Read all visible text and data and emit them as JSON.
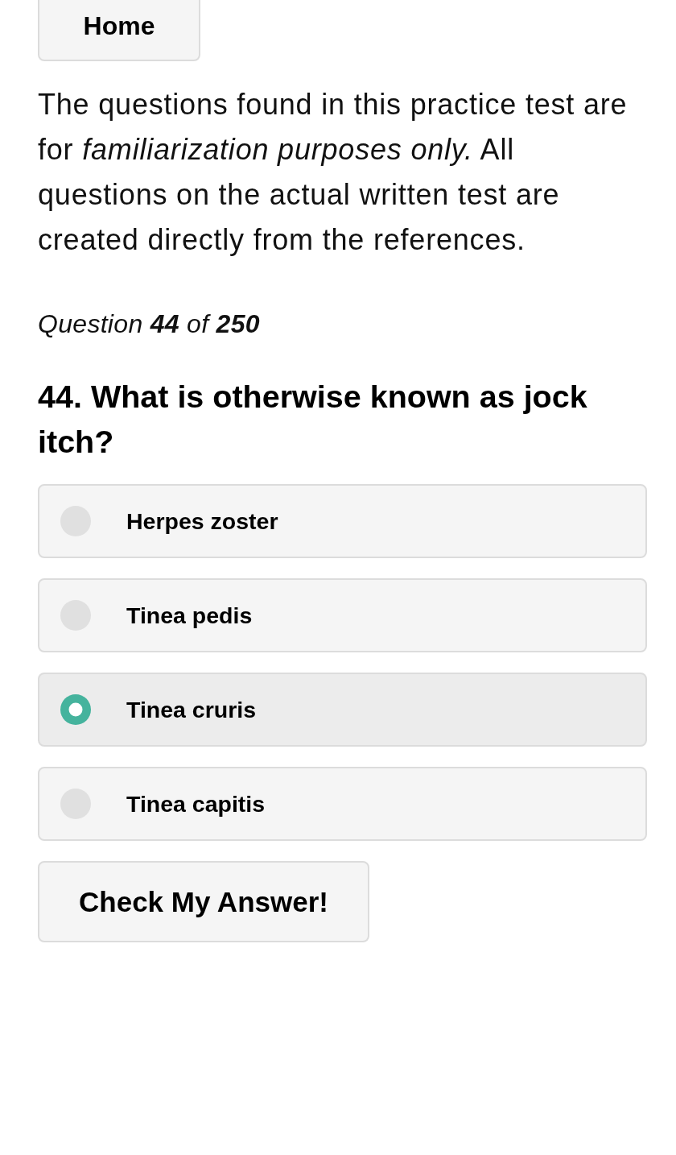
{
  "nav": {
    "home_button": "Home"
  },
  "intro": "The questions found in this practice test are for *familiarization purposes only.* All questions on the actual written test are created directly from the references.",
  "progress": "Question **44** of **250**",
  "question": "44. What is otherwise known as jock itch?",
  "options": [
    {
      "label": "Herpes zoster",
      "selected": false
    },
    {
      "label": "Tinea pedis",
      "selected": false
    },
    {
      "label": "Tinea cruris",
      "selected": true
    },
    {
      "label": "Tinea capitis",
      "selected": false
    }
  ],
  "check_button": "Check My Answer!"
}
